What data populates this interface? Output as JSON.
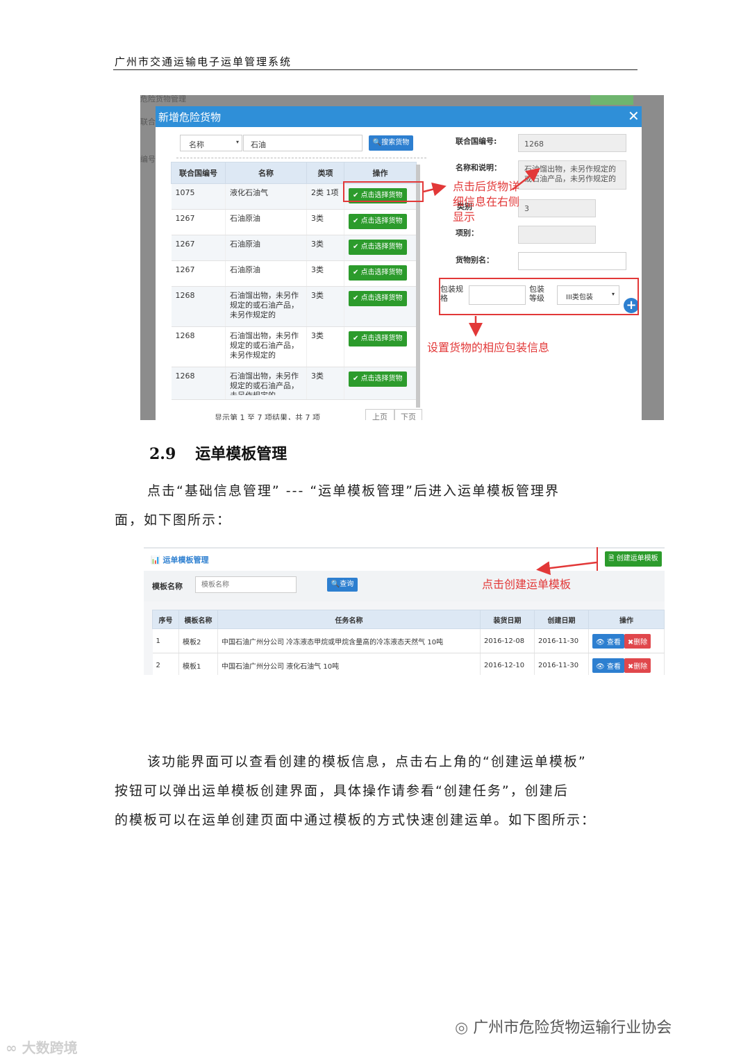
{
  "header": {
    "title": "广州市交通运输电子运单管理系统"
  },
  "figure1": {
    "background_texts": [
      "危险货物管理",
      "联合",
      "编号"
    ],
    "modal_title": "新增危险货物",
    "close_symbol": "✕",
    "search": {
      "field_select": "名称",
      "value": "石油",
      "button": "搜索货物"
    },
    "table": {
      "headers": [
        "联合国编号",
        "名称",
        "类项",
        "操作"
      ],
      "rows": [
        {
          "un": "1075",
          "name": "液化石油气",
          "class": "2类 1项",
          "action": "点击选择货物"
        },
        {
          "un": "1267",
          "name": "石油原油",
          "class": "3类",
          "action": "点击选择货物"
        },
        {
          "un": "1267",
          "name": "石油原油",
          "class": "3类",
          "action": "点击选择货物"
        },
        {
          "un": "1267",
          "name": "石油原油",
          "class": "3类",
          "action": "点击选择货物"
        },
        {
          "un": "1268",
          "name": "石油馏出物，未另作规定的或石油产品，未另作规定的",
          "class": "3类",
          "action": "点击选择货物"
        },
        {
          "un": "1268",
          "name": "石油馏出物，未另作规定的或石油产品，未另作规定的",
          "class": "3类",
          "action": "点击选择货物"
        },
        {
          "un": "1268",
          "name": "石油馏出物，未另作规定的或石油产品，未另作规定的",
          "class": "3类",
          "action": "点击选择货物"
        }
      ]
    },
    "pager": {
      "info": "显示第 1 至 7 项结果，共 7 项",
      "prev": "上页",
      "next": "下页"
    },
    "detail": {
      "un_label": "联合国编号:",
      "un_value": "1268",
      "name_label": "名称和说明：",
      "name_value": "石油馏出物，未另作规定的或石油产品，未另作规定的",
      "class_label": "类别",
      "class_value": "3",
      "item_label": "项别：",
      "alias_label": "货物别名：",
      "pkg_spec_label": "包装规格",
      "pkg_level_label": "包装等级",
      "pkg_level_value": "III类包装",
      "add_symbol": "+"
    },
    "annotation1": "点击后货物详细信息在右侧显示",
    "annotation2": "设置货物的相应包装信息"
  },
  "section": {
    "number": "2.9",
    "title": "运单模板管理"
  },
  "para1_line1": "点击“基础信息管理” --- “运单模板管理”后进入运单模板管理界",
  "para1_line2": "面，如下图所示：",
  "figure2": {
    "breadcrumb": "运单模板管理",
    "create_button": "创建运单模板",
    "filter_label": "模板名称",
    "filter_placeholder": "模板名称",
    "query_button": "查询",
    "annotation": "点击创建运单模板",
    "table": {
      "headers": [
        "序号",
        "模板名称",
        "任务名称",
        "装货日期",
        "创建日期",
        "操作"
      ],
      "rows": [
        {
          "no": "1",
          "name": "模板2",
          "task": "中国石油广州分公司 冷冻液态甲烷或甲烷含量高的冷冻液态天然气 10吨",
          "load_date": "2016-12-08",
          "create_date": "2016-11-30",
          "view": "查看",
          "delete": "删除"
        },
        {
          "no": "2",
          "name": "模板1",
          "task": "中国石油广州分公司 液化石油气 10吨",
          "load_date": "2016-12-10",
          "create_date": "2016-11-30",
          "view": "查看",
          "delete": "删除"
        }
      ]
    }
  },
  "para2_line1": "该功能界面可以查看创建的模板信息，点击右上角的“创建运单模板”",
  "para2_line2": "按钮可以弹出运单模板创建界面，具体操作请参看“创建任务”，创建后",
  "para2_line3": "的模板可以在运单创建页面中通过模板的方式快速创建运单。如下图所示：",
  "watermark_right": "广州市危险货物运输行业协会",
  "watermark_left": "大数跨境"
}
